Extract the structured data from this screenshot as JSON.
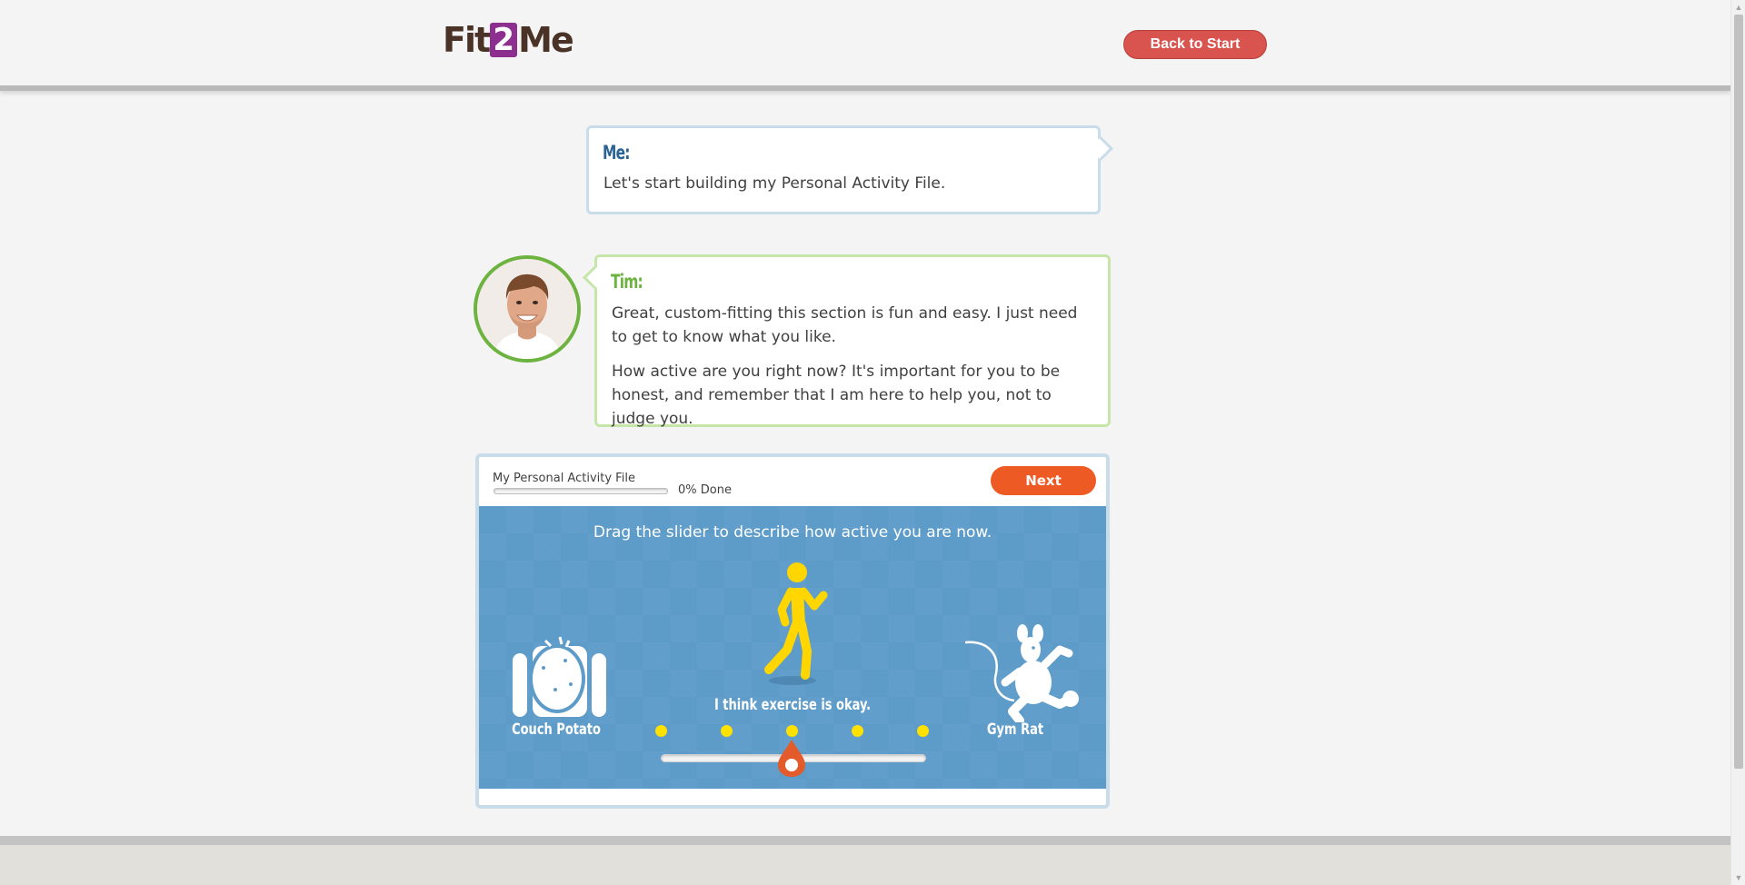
{
  "header": {
    "logo_prefix": "Fit",
    "logo_two": "2",
    "logo_suffix": "Me",
    "back_label": "Back to Start"
  },
  "conversation": {
    "me": {
      "speaker": "Me:",
      "message": "Let's start building my Personal Activity File."
    },
    "tim": {
      "speaker": "Tim:",
      "messages": [
        "Great, custom-fitting this section is fun and easy. I just need to get to know what you like.",
        "How active are you right now? It's important for you to be honest, and remember that I am here to help you, not to judge you."
      ]
    }
  },
  "activity_panel": {
    "title": "My Personal Activity File",
    "progress_percent": 0,
    "progress_label": "0% Done",
    "next_label": "Next",
    "instruction": "Drag the slider to describe how active you are now.",
    "left_label": "Couch Potato",
    "right_label": "Gym Rat",
    "current_level_text": "I think exercise is okay.",
    "slider_steps": 5,
    "slider_selected_index": 2
  },
  "colors": {
    "accent_orange": "#ee5a24",
    "back_button_red": "#d9534f",
    "tim_green": "#6db33f",
    "me_blue": "#2a6496",
    "activity_background": "#5d9bc9",
    "dot_yellow": "#ffe100",
    "walker_yellow": "#ffd600"
  },
  "icons": {
    "walker": "walking-person-icon",
    "couch": "couch-potato-icon",
    "gym": "gym-rat-icon"
  }
}
